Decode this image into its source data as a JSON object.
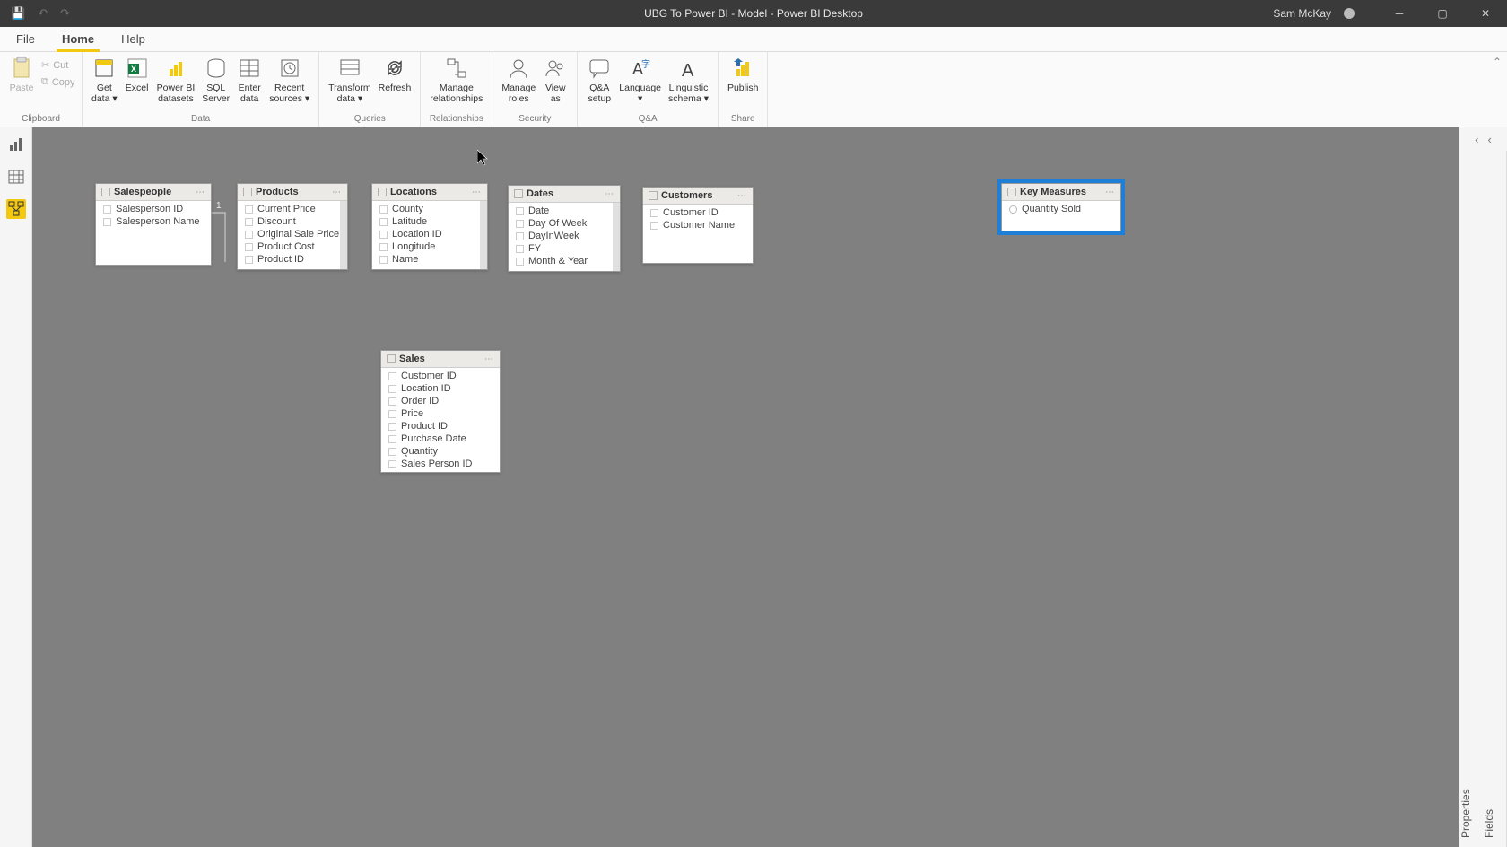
{
  "title": "UBG To Power BI - Model - Power BI Desktop",
  "user": "Sam McKay",
  "menu": {
    "file": "File",
    "home": "Home",
    "help": "Help"
  },
  "ribbon": {
    "clipboard": {
      "paste": "Paste",
      "cut": "Cut",
      "copy": "Copy",
      "group": "Clipboard"
    },
    "data": {
      "get": "Get\ndata",
      "excel": "Excel",
      "pbi": "Power BI\ndatasets",
      "sql": "SQL\nServer",
      "enter": "Enter\ndata",
      "recent": "Recent\nsources",
      "group": "Data"
    },
    "queries": {
      "transform": "Transform\ndata",
      "refresh": "Refresh",
      "group": "Queries"
    },
    "relationships": {
      "manage": "Manage\nrelationships",
      "group": "Relationships"
    },
    "security": {
      "roles": "Manage\nroles",
      "viewas": "View\nas",
      "group": "Security"
    },
    "qa": {
      "setup": "Q&A\nsetup",
      "lang": "Language",
      "schema": "Linguistic\nschema",
      "group": "Q&A"
    },
    "share": {
      "publish": "Publish",
      "group": "Share"
    }
  },
  "panes": {
    "properties": "Properties",
    "fields": "Fields"
  },
  "tables": {
    "salespeople": {
      "name": "Salespeople",
      "fields": [
        "Salesperson ID",
        "Salesperson Name"
      ]
    },
    "products": {
      "name": "Products",
      "fields": [
        "Current Price",
        "Discount",
        "Original Sale Price",
        "Product Cost",
        "Product ID"
      ]
    },
    "locations": {
      "name": "Locations",
      "fields": [
        "County",
        "Latitude",
        "Location ID",
        "Longitude",
        "Name"
      ]
    },
    "dates": {
      "name": "Dates",
      "fields": [
        "Date",
        "Day Of Week",
        "DayInWeek",
        "FY",
        "Month & Year"
      ]
    },
    "customers": {
      "name": "Customers",
      "fields": [
        "Customer ID",
        "Customer Name"
      ]
    },
    "sales": {
      "name": "Sales",
      "fields": [
        "Customer ID",
        "Location ID",
        "Order ID",
        "Price",
        "Product ID",
        "Purchase Date",
        "Quantity",
        "Sales Person ID"
      ]
    },
    "keymeasures": {
      "name": "Key Measures",
      "fields": [
        "Quantity Sold"
      ]
    }
  },
  "cardinality": {
    "one": "1",
    "many": "*"
  }
}
